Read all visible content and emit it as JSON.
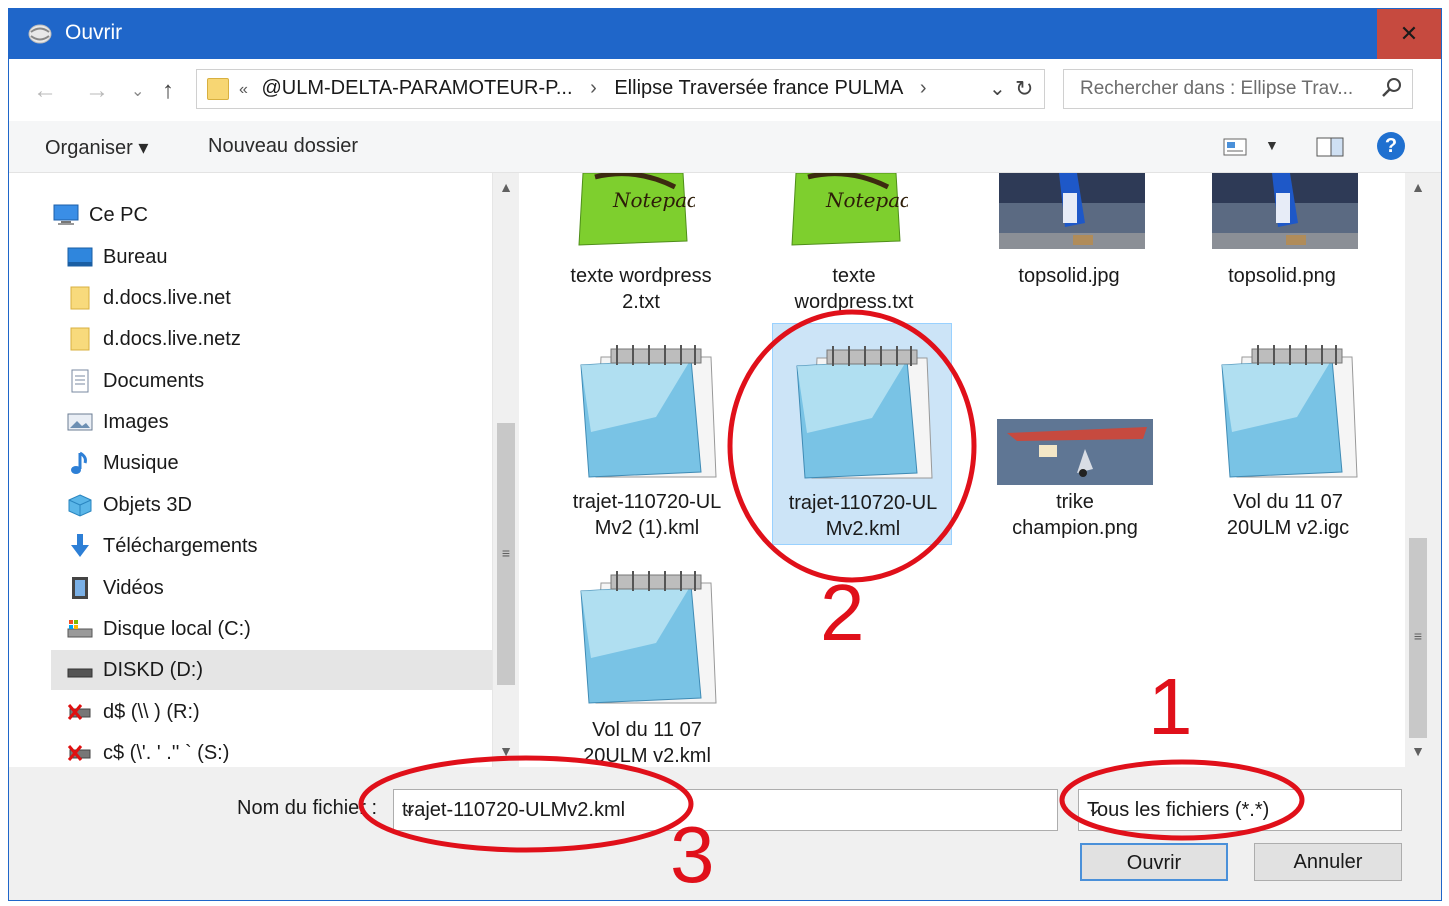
{
  "window": {
    "title": "Ouvrir",
    "close": "✕"
  },
  "nav": {
    "back": "←",
    "forward": "→",
    "recent": "⌄",
    "up": "↑",
    "crumbs": [
      "«",
      "@ULM-DELTA-PARAMOTEUR-P...",
      "Ellipse Traversée france PULMA"
    ],
    "sep": "›",
    "search_placeholder": "Rechercher dans : Ellipse Trav..."
  },
  "toolbar": {
    "organize": "Organiser ▾",
    "new_folder": "Nouveau dossier",
    "help": "?"
  },
  "tree": [
    {
      "label": "Ce PC",
      "icon": "computer-icon"
    },
    {
      "label": "Bureau",
      "icon": "desktop-icon"
    },
    {
      "label": "d.docs.live.net",
      "icon": "folder-icon"
    },
    {
      "label": "d.docs.live.netz",
      "icon": "folder-icon"
    },
    {
      "label": "Documents",
      "icon": "documents-icon"
    },
    {
      "label": "Images",
      "icon": "pictures-icon"
    },
    {
      "label": "Musique",
      "icon": "music-icon"
    },
    {
      "label": "Objets 3D",
      "icon": "objects3d-icon"
    },
    {
      "label": "Téléchargements",
      "icon": "downloads-icon"
    },
    {
      "label": "Vidéos",
      "icon": "videos-icon"
    },
    {
      "label": "Disque local (C:)",
      "icon": "local-disk-icon"
    },
    {
      "label": "DISKD (D:)",
      "icon": "drive-icon",
      "selected": true
    },
    {
      "label": "d$ (\\\\              ) (R:)",
      "icon": "network-drive-disconnected-icon"
    },
    {
      "label": "c$ (\\'.      '  .'' ` (S:)",
      "icon": "network-drive-disconnected-icon"
    }
  ],
  "files": [
    {
      "name1": "texte wordpress",
      "name2": "2.txt",
      "icon": "notepadpp-icon"
    },
    {
      "name1": "texte",
      "name2": "wordpress.txt",
      "icon": "notepadpp-icon"
    },
    {
      "name1": "topsolid.jpg",
      "name2": "",
      "icon": "image-thumbnail"
    },
    {
      "name1": "topsolid.png",
      "name2": "",
      "icon": "image-thumbnail"
    },
    {
      "name1": "trajet-110720-UL",
      "name2": "Mv2 (1).kml",
      "icon": "notepad-icon"
    },
    {
      "name1": "trajet-110720-UL",
      "name2": "Mv2.kml",
      "icon": "notepad-icon",
      "selected": true
    },
    {
      "name1": "trike",
      "name2": "champion.png",
      "icon": "image-thumbnail"
    },
    {
      "name1": "Vol du 11 07",
      "name2": "20ULM v2.igc",
      "icon": "notepad-icon"
    },
    {
      "name1": "Vol du 11 07",
      "name2": "20ULM v2.kml",
      "icon": "notepad-icon"
    }
  ],
  "bottom": {
    "filename_label": "Nom du fichier :",
    "filename_value": "trajet-110720-ULMv2.kml",
    "filetype_value": "Tous les fichiers (*.*)",
    "open_button": "Ouvrir",
    "cancel_button": "Annuler"
  },
  "annotations": {
    "mark1": "1",
    "mark2": "2",
    "mark3": "3",
    "color": "#e0101a"
  }
}
